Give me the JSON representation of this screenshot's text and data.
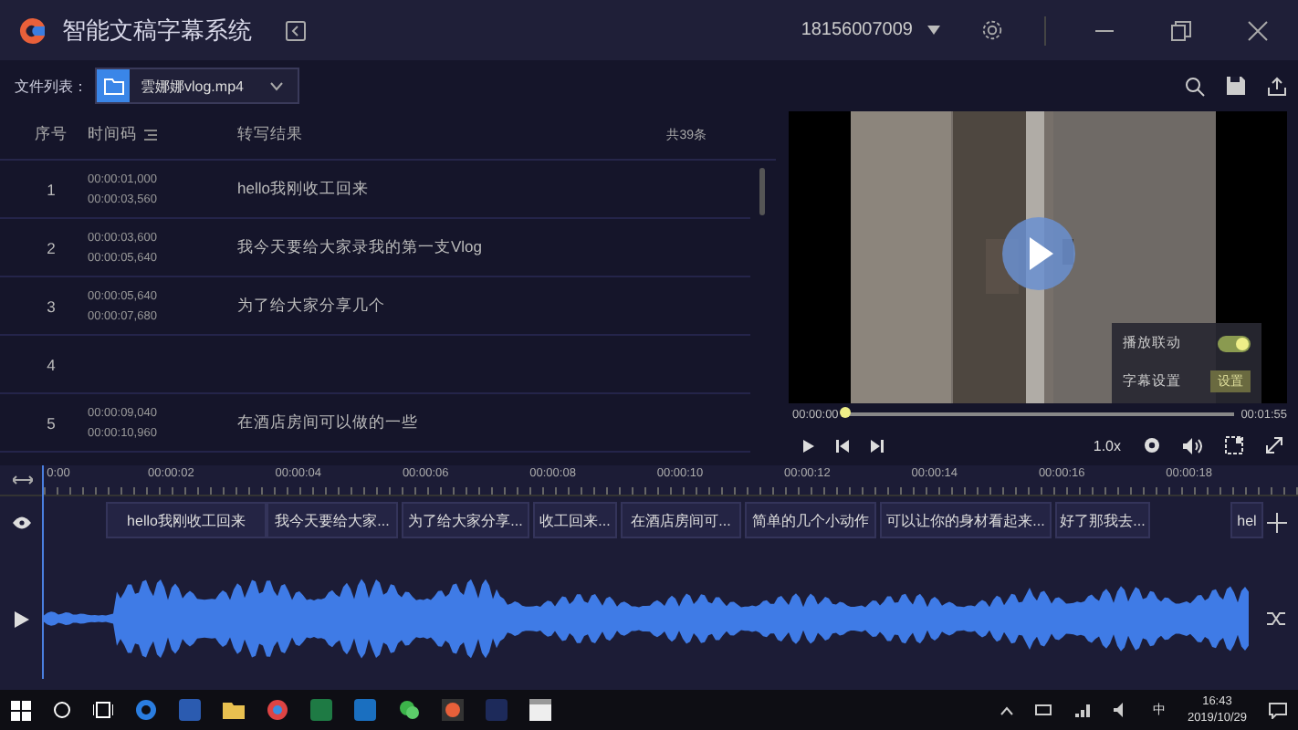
{
  "window": {
    "title": "智能文稿字幕系统",
    "account": "18156007009"
  },
  "file_bar": {
    "label": "文件列表：",
    "file": "雲娜娜vlog.mp4"
  },
  "table": {
    "columns": [
      "序号",
      "时间码",
      "转写结果"
    ],
    "count": "共39条",
    "rows": [
      {
        "index": "1",
        "start": "00:00:01,000",
        "end": "00:00:03,560",
        "text": "hello我刚收工回来"
      },
      {
        "index": "2",
        "start": "00:00:03,600",
        "end": "00:00:05,640",
        "text": "我今天要给大家录我的第一支Vlog"
      },
      {
        "index": "3",
        "start": "00:00:05,640",
        "end": "00:00:07,680",
        "text": "为了给大家分享几个"
      },
      {
        "index": "4"
      },
      {
        "index": "5",
        "start": "00:00:09,040",
        "end": "00:00:10,960",
        "text": "在酒店房间可以做的一些"
      }
    ]
  },
  "player": {
    "popup": [
      {
        "label": "播放联动",
        "kind": "toggle",
        "on": true
      },
      {
        "label": "字幕设置",
        "kind": "button",
        "button": "设置"
      }
    ],
    "current_time": "00:00:00",
    "total_time": "00:01:55",
    "progress": {
      "level": 0
    },
    "speed": "1.0x"
  },
  "timeline": {
    "ticks": [
      "0:00",
      "00:00:02",
      "00:00:04",
      "00:00:06",
      "00:00:08",
      "00:00:10",
      "00:00:12",
      "00:00:14",
      "00:00:16",
      "00:00:18"
    ],
    "clips": [
      {
        "text": "hello我刚收工回来"
      },
      {
        "text": "我今天要给大家..."
      },
      {
        "text": "为了给大家分享..."
      },
      {
        "text": "收工回来..."
      },
      {
        "text": "在酒店房间可..."
      },
      {
        "text": "简单的几个小动作"
      },
      {
        "text": "可以让你的身材看起来..."
      },
      {
        "text": "好了那我去..."
      },
      {
        "text": "hel"
      }
    ]
  },
  "taskbar": {
    "ime": "中",
    "time": "16:43",
    "date": "2019/10/29"
  }
}
